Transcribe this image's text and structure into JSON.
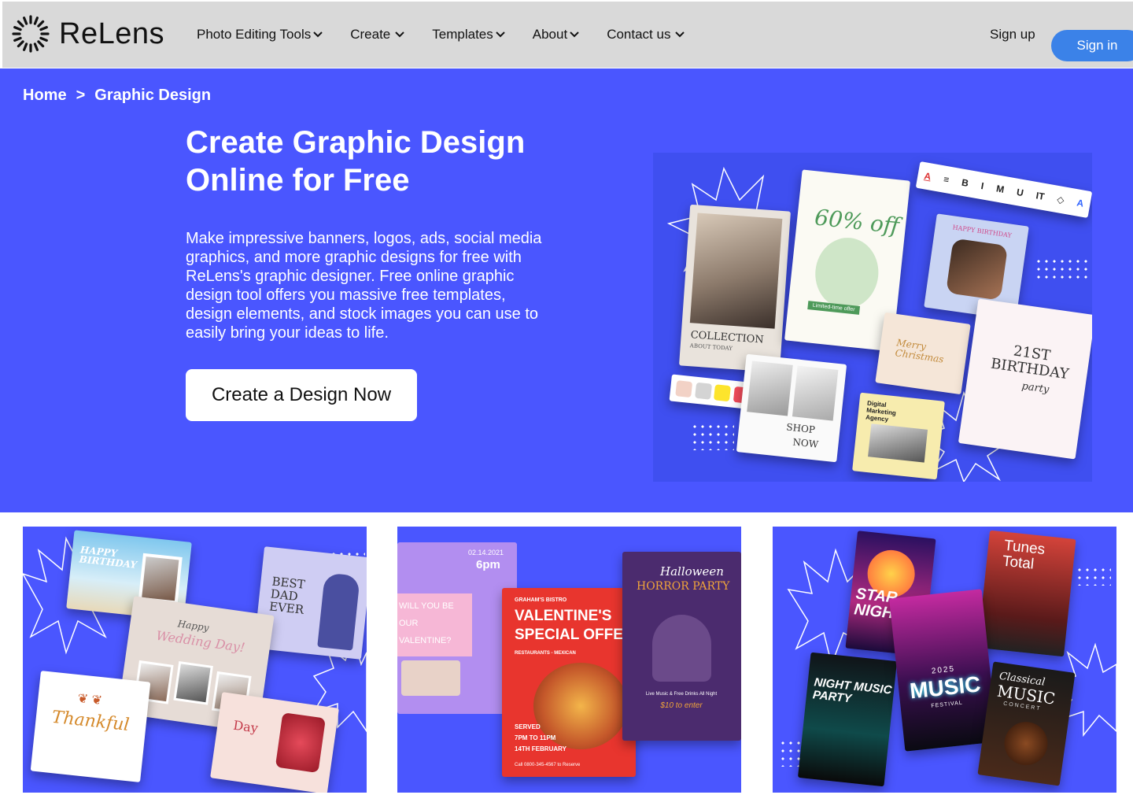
{
  "brand": {
    "name": "ReLens"
  },
  "nav": {
    "items": [
      "Photo Editing Tools",
      "Create",
      "Templates",
      "About",
      "Contact us"
    ],
    "sign_up": "Sign up",
    "sign_in": "Sign in"
  },
  "breadcrumb": {
    "home": "Home",
    "separator": ">",
    "current": "Graphic Design"
  },
  "hero": {
    "title_line1": "Create Graphic Design",
    "title_line2": "Online for Free",
    "description": "Make impressive banners, logos, ads, social media graphics, and more graphic designs for free with ReLens's graphic designer. Free online graphic design tool offers you massive free templates, design elements, and stock images you can use to easily bring your ideas to life.",
    "cta": "Create a Design Now"
  },
  "hero_art": {
    "toolbar_glyphs": [
      "A",
      "≡",
      "B",
      "I",
      "M",
      "U",
      "IT",
      "◇",
      "A"
    ],
    "cards": {
      "collection": "COLLECTION",
      "about_today": "ABOUT TODAY",
      "sale": "60% off",
      "limited": "Limited-time offer",
      "happy_birthday": "HAPPY BIRTHDAY",
      "merry_christmas": "Merry Christmas",
      "birthday_21": "21ST BIRTHDAY",
      "party": "party",
      "shop_now_1": "SHOP",
      "shop_now_2": "NOW",
      "agency": "Digital Marketing Agency"
    }
  },
  "cards": [
    {
      "theme": "greetings",
      "texts": {
        "happy_birthday": "HAPPY BIRTHDAY",
        "best_dad": "BEST DAD EVER",
        "wedding_1": "Happy",
        "wedding_2": "Wedding Day!",
        "thankful": "Thankful",
        "day": "Day"
      }
    },
    {
      "theme": "events",
      "texts": {
        "date": "02.14.2021",
        "time": "6pm",
        "will_you": "WILL YOU BE OUR VALENTINE?",
        "bistro": "GRAHAM'S BISTRO",
        "valentine_offer_1": "VALENTINE'S",
        "valentine_offer_2": "SPECIAL OFFER",
        "restaurants": "RESTAURANTS - MEXICAN",
        "served_1": "SERVED",
        "served_2": "7PM TO 11PM",
        "served_3": "14TH FEBRUARY",
        "call": "Call 0800-345-4567 to Reserve",
        "halloween_1": "Halloween",
        "halloween_2": "HORROR PARTY",
        "halloween_3": "Live Music & Free Drinks All Night",
        "halloween_4": "$10 to enter"
      }
    },
    {
      "theme": "music",
      "texts": {
        "star": "STAR NIGHT",
        "tunes_1": "Tunes",
        "tunes_2": "Total",
        "night_music": "NIGHT MUSIC PARTY",
        "year": "2025",
        "music": "MUSIC",
        "festival": "FESTIVAL",
        "classical_1": "Classical",
        "classical_2": "MUSIC",
        "concert": "CONCERT"
      }
    }
  ],
  "colors": {
    "header_bg": "#d9d9d9",
    "hero_bg": "#4a56ff",
    "signin_bg": "#3b82e8",
    "cta_bg": "#ffffff"
  }
}
